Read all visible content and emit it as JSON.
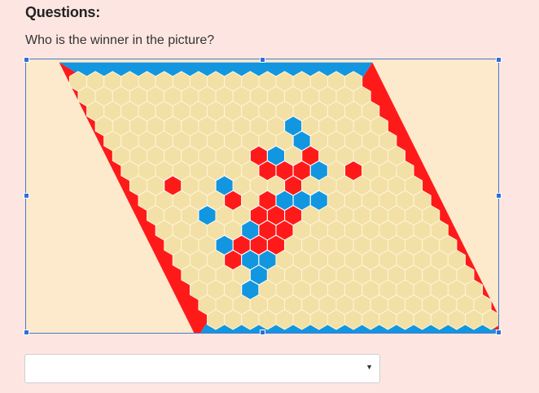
{
  "header": {
    "title": "Questions:"
  },
  "question": {
    "text": "Who is the winner in the picture?"
  },
  "board": {
    "size": 17,
    "colors": {
      "background": "#fde9cc",
      "cell_empty": "#f3e0a6",
      "cell_stroke": "#fff7dc",
      "red": "#ff1a1a",
      "blue": "#1296e0"
    },
    "edges": {
      "top": "blue",
      "bottom": "blue",
      "left": "red",
      "right": "red"
    },
    "red_stones": [
      [
        5,
        8
      ],
      [
        6,
        8
      ],
      [
        6,
        9
      ],
      [
        6,
        10
      ],
      [
        6,
        13
      ],
      [
        5,
        11
      ],
      [
        7,
        2
      ],
      [
        8,
        5
      ],
      [
        7,
        9
      ],
      [
        8,
        7
      ],
      [
        9,
        6
      ],
      [
        9,
        7
      ],
      [
        9,
        8
      ],
      [
        10,
        6
      ],
      [
        10,
        7
      ],
      [
        11,
        4
      ],
      [
        11,
        5
      ],
      [
        11,
        6
      ],
      [
        12,
        3
      ]
    ],
    "blue_stones": [
      [
        3,
        11
      ],
      [
        4,
        11
      ],
      [
        5,
        9
      ],
      [
        6,
        11
      ],
      [
        7,
        5
      ],
      [
        8,
        8
      ],
      [
        8,
        9
      ],
      [
        8,
        10
      ],
      [
        9,
        3
      ],
      [
        10,
        5
      ],
      [
        11,
        3
      ],
      [
        12,
        4
      ],
      [
        12,
        5
      ],
      [
        13,
        4
      ],
      [
        14,
        3
      ]
    ]
  },
  "answer": {
    "selected": ""
  },
  "icons": {
    "dropdown": "chevron-down-icon"
  }
}
